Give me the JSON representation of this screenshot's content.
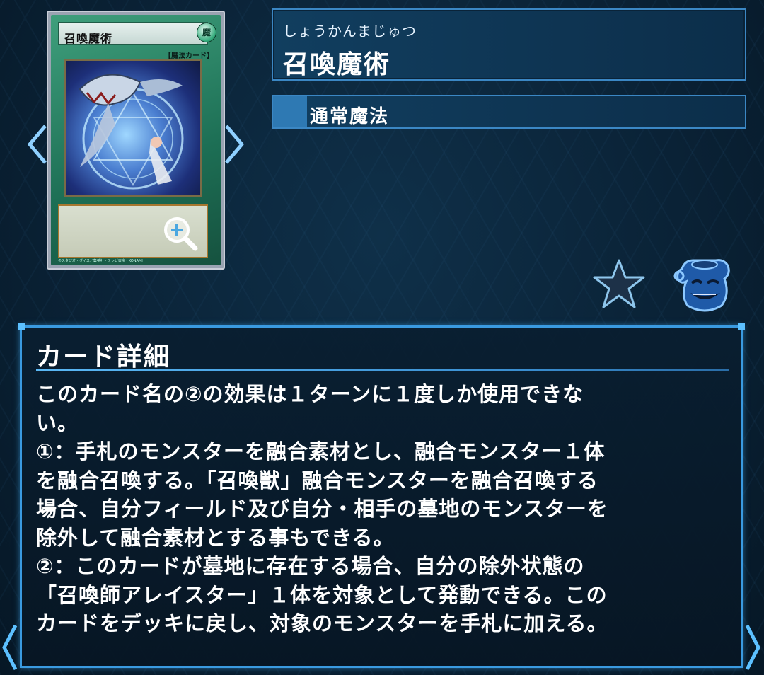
{
  "card": {
    "name": "召喚魔術",
    "attribute_icon": "魔",
    "type_line": "【魔法カード】",
    "copyright": "©スタジオ・ダイス／集英社・テレビ東京・KONAMI"
  },
  "header": {
    "reading": "しょうかんまじゅつ",
    "title": "召喚魔術",
    "spell_type": "通常魔法"
  },
  "details": {
    "heading": "カード詳細",
    "lines": [
      "このカード名の②の効果は１ターンに１度しか使用できな",
      "い。",
      "①：手札のモンスターを融合素材とし、融合モンスター１体",
      "を融合召喚する。「召喚獣」融合モンスターを融合召喚する",
      "場合、自分フィールド及び自分・相手の墓地のモンスターを",
      "除外して融合素材とする事もできる。",
      "②：このカードが墓地に存在する場合、自分の除外状態の",
      "「召喚師アレイスター」１体を対象として発動できる。この",
      "カードをデッキに戻し、対象のモンスターを手札に加える。"
    ]
  },
  "icons": {
    "favorite": "star-icon",
    "pot": "pot-of-greed-icon",
    "zoom": "zoom-in-icon",
    "prev": "chevron-left-icon",
    "next": "chevron-right-icon"
  },
  "colors": {
    "panel_border": "#3a9ae0",
    "card_green": "#1d6f55",
    "accent_blue": "#2e79b3"
  }
}
